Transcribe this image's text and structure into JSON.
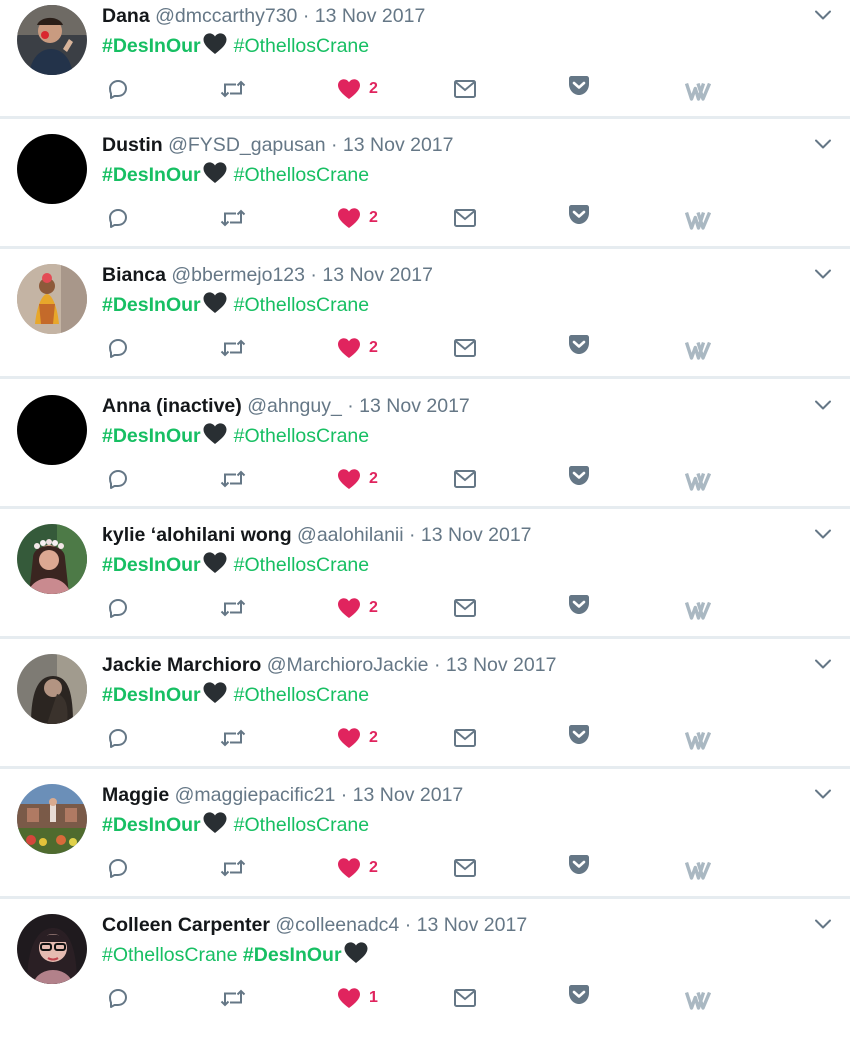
{
  "colors": {
    "accent_green": "#17bf63",
    "like_red": "#e0245e",
    "icon_gray": "#657786",
    "divider": "#e6ecf0"
  },
  "tweets": [
    {
      "name": "Dana",
      "handle": "@dmccarthy730",
      "sep": "·",
      "date": "13 Nov 2017",
      "text_parts": [
        "#DesInOur",
        "#OthellosCrane"
      ],
      "order": "des-first",
      "likes": "2",
      "avatar": "photo-person-dark"
    },
    {
      "name": "Dustin",
      "handle": "@FYSD_gapusan",
      "sep": "·",
      "date": "13 Nov 2017",
      "text_parts": [
        "#DesInOur",
        "#OthellosCrane"
      ],
      "order": "des-first",
      "likes": "2",
      "avatar": "black"
    },
    {
      "name": "Bianca",
      "handle": "@bbermejo123",
      "sep": "·",
      "date": "13 Nov 2017",
      "text_parts": [
        "#DesInOur",
        "#OthellosCrane"
      ],
      "order": "des-first",
      "likes": "2",
      "avatar": "photo-costume"
    },
    {
      "name": "Anna (inactive)",
      "handle": "@ahnguy_",
      "sep": "·",
      "date": "13 Nov 2017",
      "text_parts": [
        "#DesInOur",
        "#OthellosCrane"
      ],
      "order": "des-first",
      "likes": "2",
      "avatar": "black"
    },
    {
      "name": "kylie ‘alohilani wong",
      "handle": "@aalohilanii",
      "sep": "·",
      "date": "13 Nov 2017",
      "text_parts": [
        "#DesInOur",
        "#OthellosCrane"
      ],
      "order": "des-first",
      "likes": "2",
      "avatar": "photo-flower-crown"
    },
    {
      "name": "Jackie Marchioro",
      "handle": "@MarchioroJackie",
      "sep": "·",
      "date": "13 Nov 2017",
      "text_parts": [
        "#DesInOur",
        "#OthellosCrane"
      ],
      "order": "des-first",
      "likes": "2",
      "avatar": "photo-dark-hair"
    },
    {
      "name": "Maggie",
      "handle": "@maggiepacific21",
      "sep": "·",
      "date": "13 Nov 2017",
      "text_parts": [
        "#DesInOur",
        "#OthellosCrane"
      ],
      "order": "des-first",
      "likes": "2",
      "avatar": "photo-garden"
    },
    {
      "name": "Colleen Carpenter",
      "handle": "@colleenadc4",
      "sep": "·",
      "date": "13 Nov 2017",
      "text_parts": [
        "#OthellosCrane",
        "#DesInOur"
      ],
      "order": "crane-first",
      "likes": "1",
      "avatar": "photo-glasses"
    }
  ],
  "icons": {
    "reply": "reply-icon",
    "retweet": "retweet-icon",
    "like": "heart-icon",
    "dm": "envelope-icon",
    "pocket": "pocket-icon",
    "w": "w-logo-icon",
    "caret": "chevron-down-icon",
    "emoji": "black-heart-emoji"
  }
}
